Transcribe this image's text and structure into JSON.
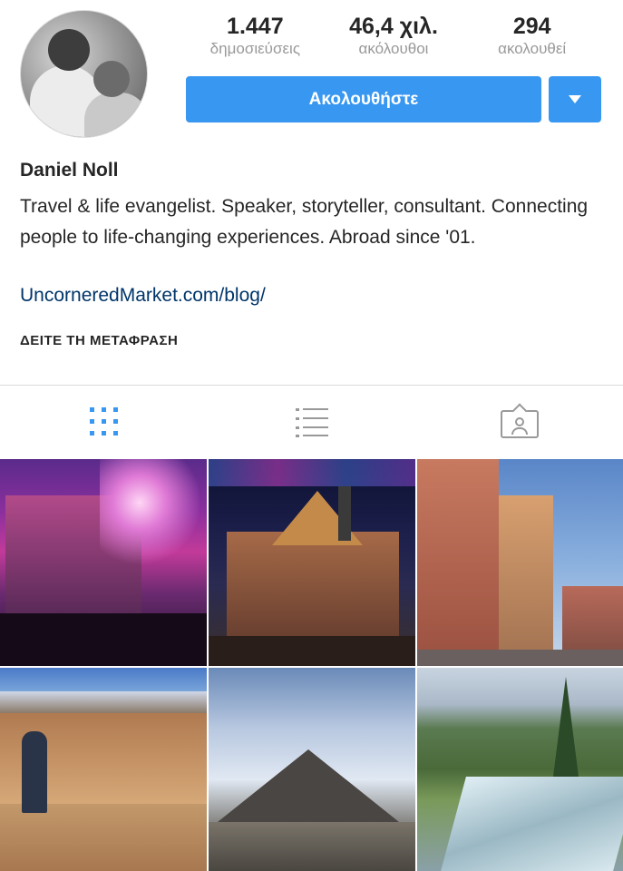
{
  "profile": {
    "stats": [
      {
        "value": "1.447",
        "label": "δημοσιεύσεις"
      },
      {
        "value": "46,4 χιλ.",
        "label": "ακόλουθοι"
      },
      {
        "value": "294",
        "label": "ακολουθεί"
      }
    ],
    "follow_label": "Ακολουθήστε",
    "name": "Daniel Noll",
    "bio": "Travel & life evangelist. Speaker, storyteller, consultant. Connecting people to life-changing experiences. Abroad since '01.",
    "link": "UncorneredMarket.com/blog/",
    "translate_label": "ΔΕΙΤΕ ΤΗ ΜΕΤΑΦΡΑΣΗ"
  },
  "tabs": [
    {
      "icon": "grid-icon",
      "active": true
    },
    {
      "icon": "list-icon",
      "active": false
    },
    {
      "icon": "tagged-icon",
      "active": false
    }
  ],
  "colors": {
    "accent": "#3897f0",
    "text": "#262626",
    "muted": "#999999",
    "link": "#003569",
    "divider": "#dbdbdb"
  },
  "posts_visible": 6
}
